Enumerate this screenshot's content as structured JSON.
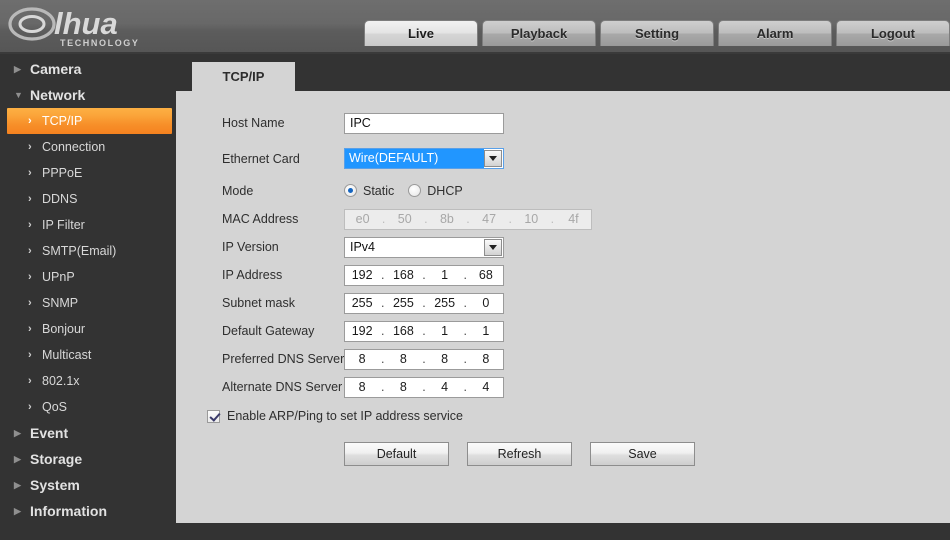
{
  "brand": {
    "name": "alhua",
    "tagline": "TECHNOLOGY"
  },
  "header": {
    "tabs": [
      {
        "label": "Live",
        "active": true
      },
      {
        "label": "Playback",
        "active": false
      },
      {
        "label": "Setting",
        "active": false
      },
      {
        "label": "Alarm",
        "active": false
      },
      {
        "label": "Logout",
        "active": false
      }
    ]
  },
  "sidebar": {
    "groups": [
      {
        "label": "Camera",
        "expanded": false,
        "icon": "caret-right-icon"
      },
      {
        "label": "Network",
        "expanded": true,
        "icon": "caret-down-icon"
      }
    ],
    "network_items": [
      {
        "label": "TCP/IP",
        "selected": true
      },
      {
        "label": "Connection",
        "selected": false
      },
      {
        "label": "PPPoE",
        "selected": false
      },
      {
        "label": "DDNS",
        "selected": false
      },
      {
        "label": "IP Filter",
        "selected": false
      },
      {
        "label": "SMTP(Email)",
        "selected": false
      },
      {
        "label": "UPnP",
        "selected": false
      },
      {
        "label": "SNMP",
        "selected": false
      },
      {
        "label": "Bonjour",
        "selected": false
      },
      {
        "label": "Multicast",
        "selected": false
      },
      {
        "label": "802.1x",
        "selected": false
      },
      {
        "label": "QoS",
        "selected": false
      }
    ],
    "bottom_groups": [
      {
        "label": "Event",
        "expanded": false,
        "icon": "caret-right-icon"
      },
      {
        "label": "Storage",
        "expanded": false,
        "icon": "caret-right-icon"
      },
      {
        "label": "System",
        "expanded": false,
        "icon": "caret-right-icon"
      },
      {
        "label": "Information",
        "expanded": false,
        "icon": "caret-right-icon"
      }
    ]
  },
  "panel": {
    "tab_label": "TCP/IP",
    "fields": {
      "host_name": {
        "label": "Host Name",
        "value": "IPC"
      },
      "ethernet_card": {
        "label": "Ethernet Card",
        "value": "Wire(DEFAULT)",
        "highlighted": true,
        "icon": "chevron-down-icon"
      },
      "mode": {
        "label": "Mode",
        "options": [
          "Static",
          "DHCP"
        ],
        "selected": "Static"
      },
      "mac_address": {
        "label": "MAC Address",
        "octets": [
          "e0",
          "50",
          "8b",
          "47",
          "10",
          "4f"
        ],
        "disabled": true
      },
      "ip_version": {
        "label": "IP Version",
        "value": "IPv4",
        "icon": "chevron-down-icon"
      },
      "ip_address": {
        "label": "IP Address",
        "octets": [
          "192",
          "168",
          "1",
          "68"
        ]
      },
      "subnet_mask": {
        "label": "Subnet mask",
        "octets": [
          "255",
          "255",
          "255",
          "0"
        ]
      },
      "default_gateway": {
        "label": "Default Gateway",
        "octets": [
          "192",
          "168",
          "1",
          "1"
        ]
      },
      "preferred_dns": {
        "label": "Preferred DNS Server",
        "octets": [
          "8",
          "8",
          "8",
          "8"
        ]
      },
      "alternate_dns": {
        "label": "Alternate DNS Server",
        "octets": [
          "8",
          "8",
          "4",
          "4"
        ]
      }
    },
    "arp_ping": {
      "label": "Enable ARP/Ping to set IP address service",
      "checked": true
    },
    "buttons": [
      {
        "label": "Default"
      },
      {
        "label": "Refresh"
      },
      {
        "label": "Save"
      }
    ]
  },
  "colors": {
    "accent_orange": "#f5821f",
    "selection_blue": "#2196ff",
    "panel_bg": "#d4d4d4",
    "sidebar_bg": "#333333",
    "header_grey": "#686868"
  }
}
